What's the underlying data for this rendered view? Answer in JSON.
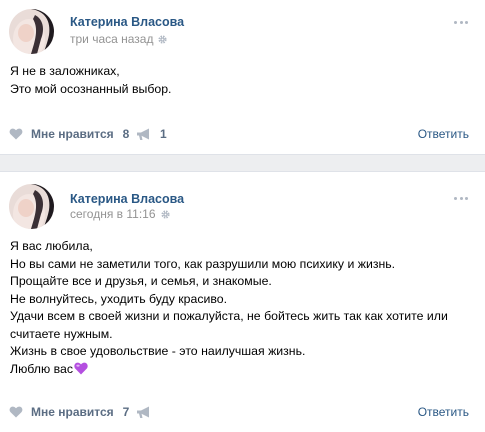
{
  "posts": [
    {
      "author": "Катерина Власова",
      "time": "три часа назад",
      "text": [
        "Я не в заложниках,",
        "Это мой осознанный выбор."
      ],
      "like_label": "Мне нравится",
      "like_count": "8",
      "share_count": "1",
      "reply_label": "Ответить"
    },
    {
      "author": "Катерина Власова",
      "time": "сегодня в 11:16",
      "text": [
        "Я вас любила,",
        "Но вы сами не заметили того, как разрушили мою психику и жизнь.",
        "Прощайте все и друзья, и семья, и знакомые.",
        "Не волнуйтесь, уходить буду красиво.",
        "Удачи всем в своей жизни и пожалуйста, не бойтесь жить так как хотите или",
        "считаете нужным.",
        "Жизнь в свое удовольствие - это наилучшая жизнь.",
        "Люблю вас"
      ],
      "like_label": "Мне нравится",
      "like_count": "7",
      "share_count": "",
      "reply_label": "Ответить"
    }
  ],
  "icons": {
    "like": "heart-icon",
    "share": "megaphone-icon",
    "time_settings": "gear-icon",
    "menu": "more-icon",
    "emoji": "purple-heart-emoji"
  },
  "colors": {
    "link": "#2a5885",
    "muted": "#939393",
    "action": "#5b6d83",
    "icon": "#b0b8c3",
    "separator": "#edeef0",
    "emoji": "#b44fe0"
  }
}
